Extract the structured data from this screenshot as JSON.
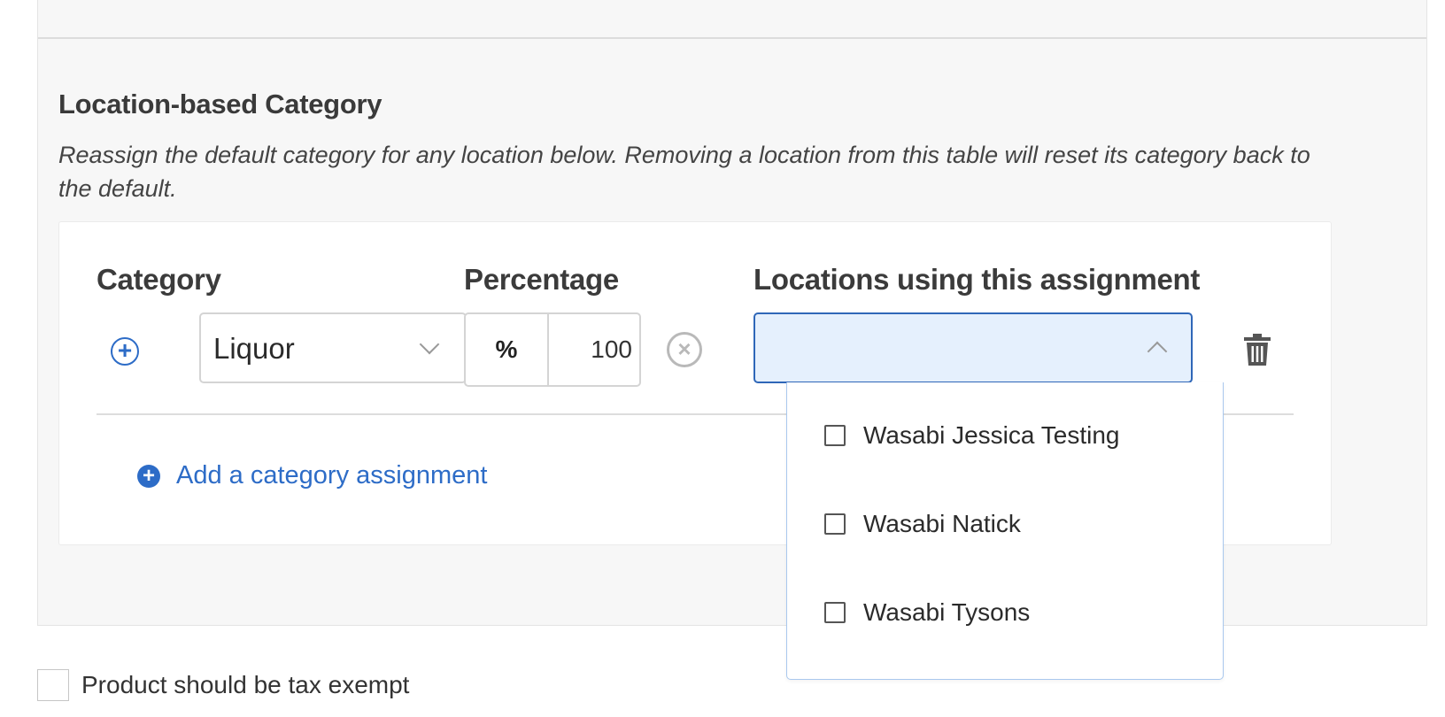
{
  "section": {
    "title": "Location-based Category",
    "description": "Reassign the default category for any location below. Removing a location from this table will reset its category back to the default."
  },
  "table": {
    "headers": {
      "category": "Category",
      "percentage": "Percentage",
      "locations": "Locations using this assignment"
    },
    "row": {
      "category_value": "Liquor",
      "percent_symbol": "%",
      "percentage_value": "100",
      "locations_value": ""
    },
    "add_label": "Add a category assignment"
  },
  "dropdown": {
    "options": [
      {
        "label": "Wasabi Jessica Testing",
        "checked": false
      },
      {
        "label": "Wasabi Natick",
        "checked": false
      },
      {
        "label": "Wasabi Tysons",
        "checked": false
      }
    ]
  },
  "tax_exempt": {
    "label": "Product should be tax exempt",
    "checked": false
  },
  "colors": {
    "accent": "#2d6cc7",
    "active_select_bg": "#e5f0fd",
    "panel_bg": "#f7f7f7"
  },
  "icons": {
    "add_row": "plus-circle-outline",
    "clear": "x-circle",
    "delete": "trash",
    "add_assignment": "plus-circle-filled"
  }
}
